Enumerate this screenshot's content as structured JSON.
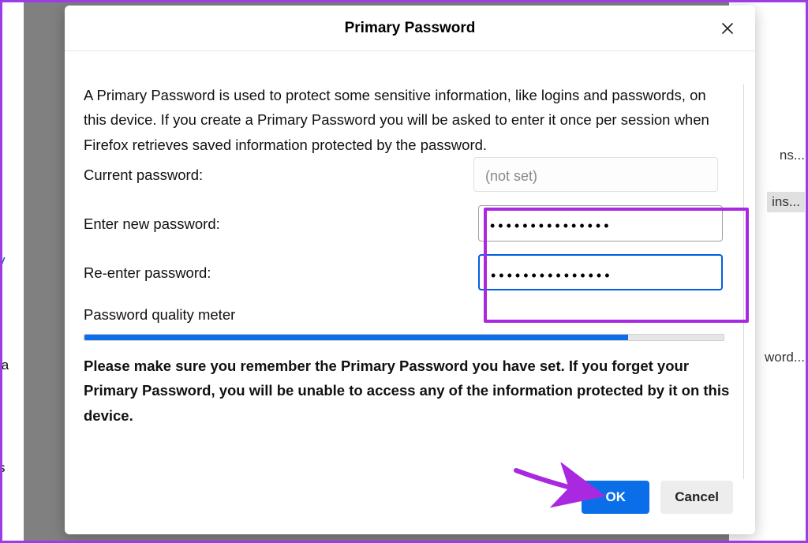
{
  "background": {
    "right_items": [
      "ns...",
      "ins...",
      "word..."
    ],
    "left_items": [
      "y",
      "la",
      "s"
    ]
  },
  "dialog": {
    "title": "Primary Password",
    "intro": "A Primary Password is used to protect some sensitive information, like logins and passwords, on this device. If you create a Primary Password you will be asked to enter it once per session when Firefox retrieves saved information protected by the password.",
    "current_label": "Current password:",
    "current_placeholder": "(not set)",
    "new_label": "Enter new password:",
    "new_value": "•••••••••••••••",
    "reenter_label": "Re-enter password:",
    "reenter_value": "•••••••••••••••",
    "meter_label": "Password quality meter",
    "meter_percent": 85,
    "warning": "Please make sure you remember the Primary Password you have set. If you forget your Primary Password, you will be unable to access any of the information protected by it on this device.",
    "ok_label": "OK",
    "cancel_label": "Cancel"
  },
  "annotation": {
    "arrow_color": "#a829e0"
  }
}
